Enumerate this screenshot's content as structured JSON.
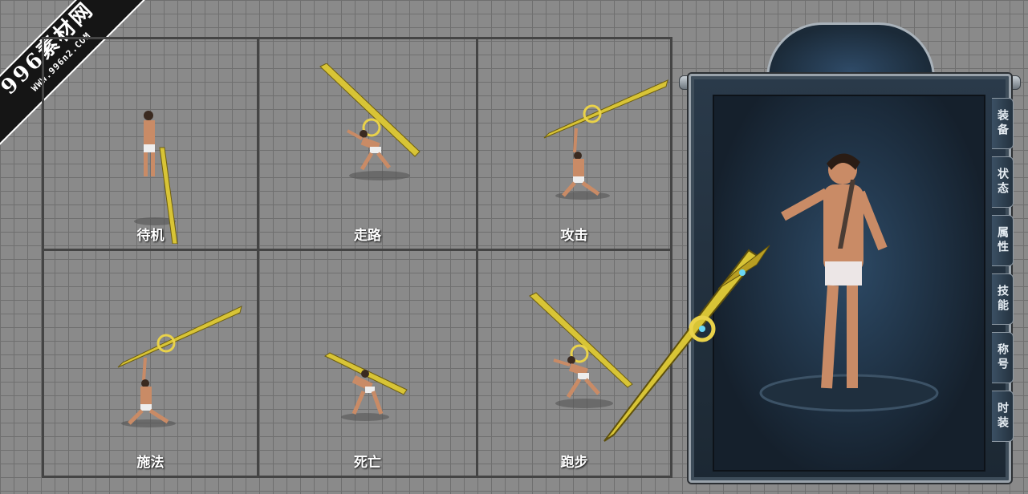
{
  "watermark": {
    "title": "996素材网",
    "url": "WWW.996n2.COM"
  },
  "animations": [
    {
      "label": "待机"
    },
    {
      "label": "走路"
    },
    {
      "label": "攻击"
    },
    {
      "label": "施法"
    },
    {
      "label": "死亡"
    },
    {
      "label": "跑步"
    }
  ],
  "side_tabs": [
    {
      "label": "装备"
    },
    {
      "label": "状态"
    },
    {
      "label": "属性"
    },
    {
      "label": "技能"
    },
    {
      "label": "称号"
    },
    {
      "label": "时装"
    }
  ],
  "colors": {
    "panel_bg": "#1c2833",
    "blade_gold": "#d8c436",
    "skin": "#c98b66"
  }
}
